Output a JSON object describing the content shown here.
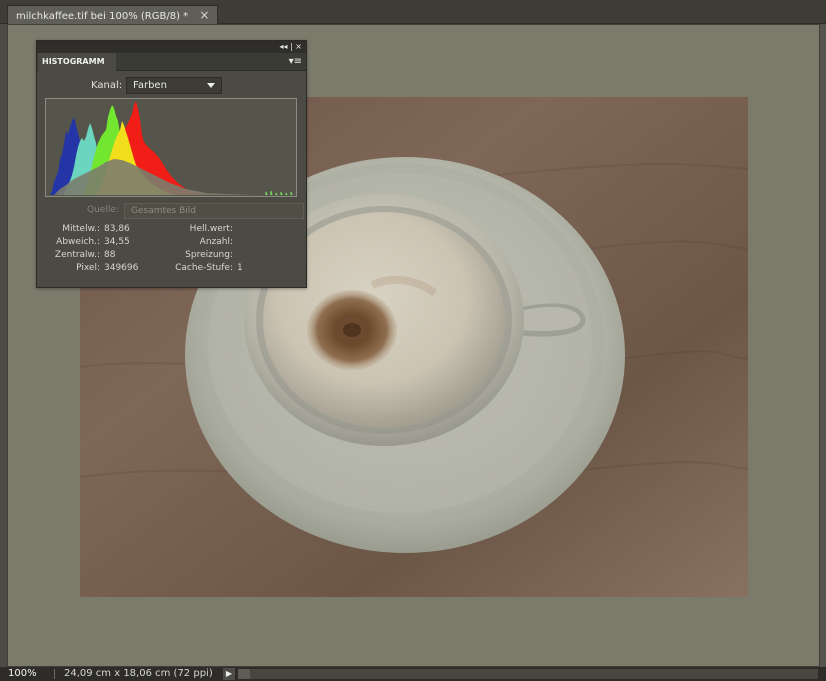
{
  "document": {
    "tab_title": "milchkaffee.tif bei 100% (RGB/8) *",
    "close_glyph": "×"
  },
  "panel": {
    "tab_label": "HISTOGRAMM",
    "top_controls": "◂◂ | ×",
    "menu_icon": "▾≡",
    "kanal_label": "Kanal:",
    "kanal_value": "Farben",
    "source_label": "Quelle:",
    "source_value": "Gesamtes Bild",
    "stats_left": [
      {
        "label": "Mittelw.:",
        "value": "83,86"
      },
      {
        "label": "Abweich.:",
        "value": "34,55"
      },
      {
        "label": "Zentralw.:",
        "value": "88"
      },
      {
        "label": "Pixel:",
        "value": "349696"
      }
    ],
    "stats_right": [
      {
        "label": "Hell.wert:",
        "value": ""
      },
      {
        "label": "Anzahl:",
        "value": ""
      },
      {
        "label": "Spreizung:",
        "value": ""
      },
      {
        "label": "Cache-Stufe:",
        "value": "1"
      }
    ]
  },
  "status": {
    "zoom": "100%",
    "doc_info": "24,09 cm x 18,06 cm (72 ppi)",
    "arrow": "▶"
  },
  "colors": {
    "hist_blue": "#2234a6",
    "hist_green": "#73e82d",
    "hist_red": "#ee1d16",
    "hist_yellow": "#f2e11c",
    "hist_cyan": "#68d4c0",
    "hist_gray": "#7d7d6c"
  }
}
